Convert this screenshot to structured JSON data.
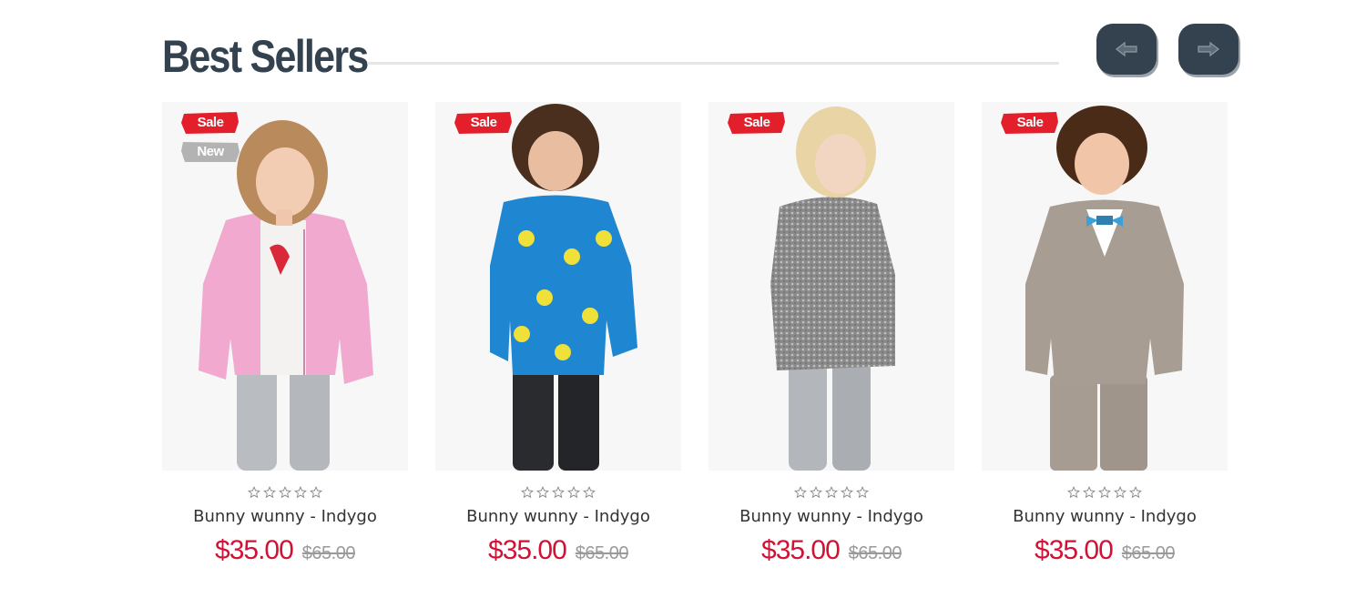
{
  "section": {
    "title": "Best Sellers"
  },
  "nav": {
    "prev_icon": "arrow-left-icon",
    "next_icon": "arrow-right-icon"
  },
  "colors": {
    "dark_slate": "#34424f",
    "sale_red": "#e31f2c",
    "new_gray": "#b3b3b3",
    "price_red": "#d21234",
    "old_price_gray": "#9a9a9a"
  },
  "products": [
    {
      "image": "girl-pink-quilted-jacket",
      "badges": {
        "sale": "Sale",
        "new": "New"
      },
      "rating": {
        "value": 0,
        "max": 5
      },
      "name": "Bunny wunny - Indygo",
      "price": "$35.00",
      "old_price": "$65.00"
    },
    {
      "image": "boy-blue-minion-fleece",
      "badges": {
        "sale": "Sale"
      },
      "rating": {
        "value": 0,
        "max": 5
      },
      "name": "Bunny wunny - Indygo",
      "price": "$35.00",
      "old_price": "$65.00"
    },
    {
      "image": "girl-gray-hoodie",
      "badges": {
        "sale": "Sale"
      },
      "rating": {
        "value": 0,
        "max": 5
      },
      "name": "Bunny wunny - Indygo",
      "price": "$35.00",
      "old_price": "$65.00"
    },
    {
      "image": "boy-beige-suit-bowtie",
      "badges": {
        "sale": "Sale"
      },
      "rating": {
        "value": 0,
        "max": 5
      },
      "name": "Bunny wunny - Indygo",
      "price": "$35.00",
      "old_price": "$65.00"
    }
  ]
}
